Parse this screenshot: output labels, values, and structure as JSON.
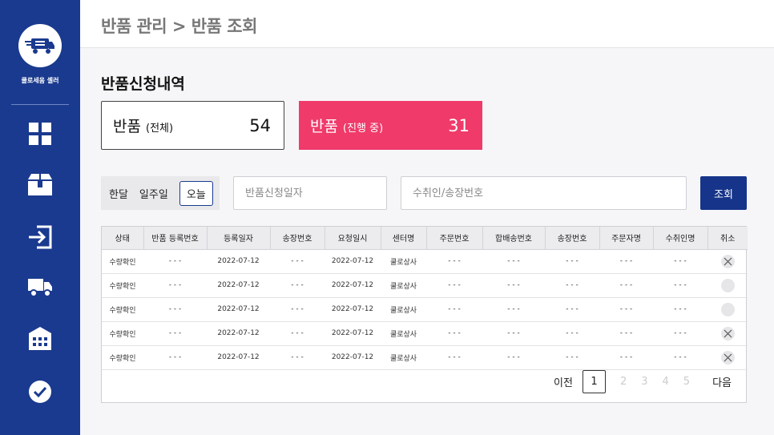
{
  "sidebar": {
    "brand": "쿨로세움 셀러",
    "items": [
      {
        "icon": "dashboard-icon"
      },
      {
        "icon": "package-icon"
      },
      {
        "icon": "login-icon"
      },
      {
        "icon": "truck-icon"
      },
      {
        "icon": "warehouse-icon"
      },
      {
        "icon": "check-circle-icon"
      }
    ]
  },
  "header": {
    "breadcrumb": "반품 관리 > 반품 조회"
  },
  "main": {
    "title": "반품신청내역",
    "stats": {
      "total_label": "반품",
      "total_sub": "(전체)",
      "total_value": "54",
      "progress_label": "반품",
      "progress_sub": "(진행 중)",
      "progress_value": "31"
    },
    "period": {
      "month": "한달",
      "week": "일주일",
      "today": "오늘"
    },
    "date_placeholder": "반품신청일자",
    "keyword_placeholder": "수취인/송장번호",
    "search_label": "조회"
  },
  "table": {
    "headers": [
      "상태",
      "반품 등록번호",
      "등록일자",
      "송장번호",
      "요청일시",
      "센터명",
      "주문번호",
      "합배송번호",
      "송장번호",
      "주문자명",
      "수취인명",
      "취소"
    ],
    "rows": [
      [
        "수량확인",
        "- - -",
        "2022-07-12",
        "- - -",
        "2022-07-12",
        "쿨로상사",
        "- - -",
        "- - -",
        "- - -",
        "- - -",
        "- - -",
        "x"
      ],
      [
        "수량확인",
        "- - -",
        "2022-07-12",
        "- - -",
        "2022-07-12",
        "쿨로상사",
        "- - -",
        "- - -",
        "- - -",
        "- - -",
        "- - -",
        ""
      ],
      [
        "수량확인",
        "- - -",
        "2022-07-12",
        "- - -",
        "2022-07-12",
        "쿨로상사",
        "- - -",
        "- - -",
        "- - -",
        "- - -",
        "- - -",
        ""
      ],
      [
        "수량확인",
        "- - -",
        "2022-07-12",
        "- - -",
        "2022-07-12",
        "쿨로상사",
        "- - -",
        "- - -",
        "- - -",
        "- - -",
        "- - -",
        "x"
      ],
      [
        "수량확인",
        "- - -",
        "2022-07-12",
        "- - -",
        "2022-07-12",
        "쿨로상사",
        "- - -",
        "- - -",
        "- - -",
        "- - -",
        "- - -",
        "x"
      ]
    ]
  },
  "pagination": {
    "prev": "이전",
    "next": "다음",
    "pages": [
      "1",
      "2",
      "3",
      "4",
      "5"
    ]
  },
  "colors": {
    "sidebar": "#1a3a8f",
    "accent": "#ef3a6a",
    "button": "#16348a"
  }
}
